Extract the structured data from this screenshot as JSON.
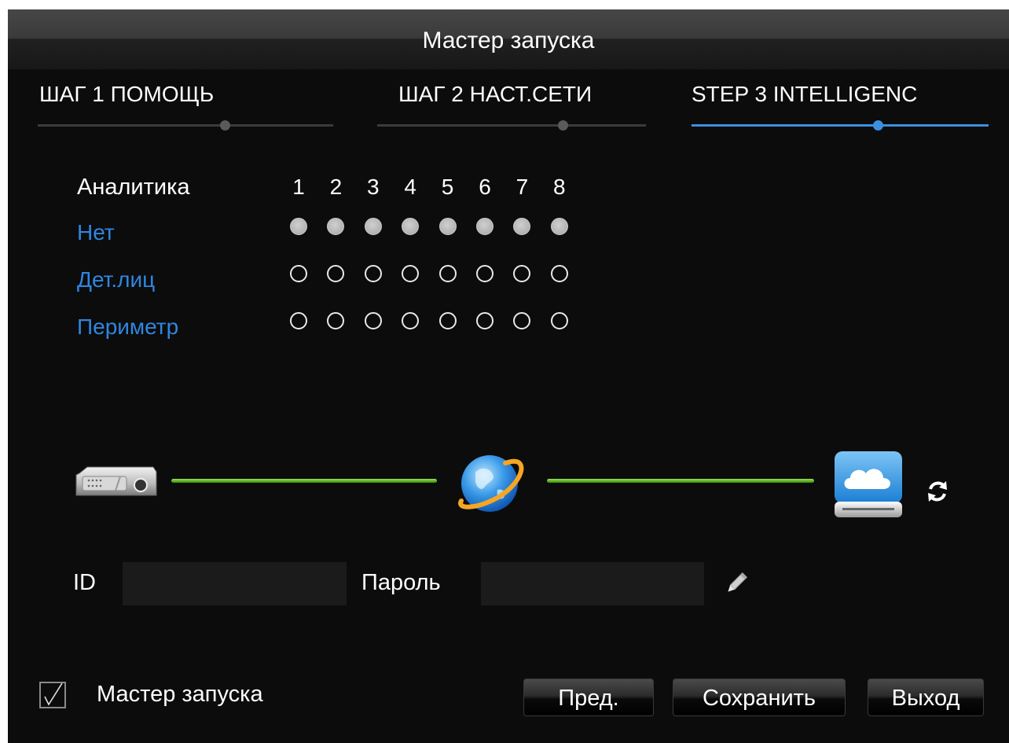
{
  "window": {
    "title": "Мастер запуска"
  },
  "steps": [
    {
      "label": "ШАГ 1 ПОМОЩЬ",
      "active": false
    },
    {
      "label": "ШАГ 2 НАСТ.СЕТИ",
      "active": false
    },
    {
      "label": "STEP 3 INTELLIGENC",
      "active": true
    }
  ],
  "analytics": {
    "title": "Аналитика",
    "channels": [
      "1",
      "2",
      "3",
      "4",
      "5",
      "6",
      "7",
      "8"
    ],
    "rows": [
      {
        "label": "Нет",
        "selected": [
          true,
          true,
          true,
          true,
          true,
          true,
          true,
          true
        ]
      },
      {
        "label": "Дет.лиц",
        "selected": [
          false,
          false,
          false,
          false,
          false,
          false,
          false,
          false
        ]
      },
      {
        "label": "Периметр",
        "selected": [
          false,
          false,
          false,
          false,
          false,
          false,
          false,
          false
        ]
      }
    ]
  },
  "connection": {
    "device_icon": "dvr-device-icon",
    "network_icon": "internet-globe-icon",
    "cloud_icon": "cloud-storage-icon",
    "refresh_icon": "refresh-icon",
    "link_color": "#5cb020"
  },
  "credentials": {
    "id_label": "ID",
    "id_value": "",
    "password_label": "Пароль",
    "password_value": "",
    "edit_icon": "pencil-icon"
  },
  "footer": {
    "wizard_checkbox_label": "Мастер запуска",
    "wizard_checkbox_checked": true,
    "prev_label": "Пред.",
    "save_label": "Сохранить",
    "exit_label": "Выход"
  },
  "colors": {
    "accent": "#3c8fe0",
    "row_label": "#2f86e0",
    "background": "#0c0c0c"
  }
}
